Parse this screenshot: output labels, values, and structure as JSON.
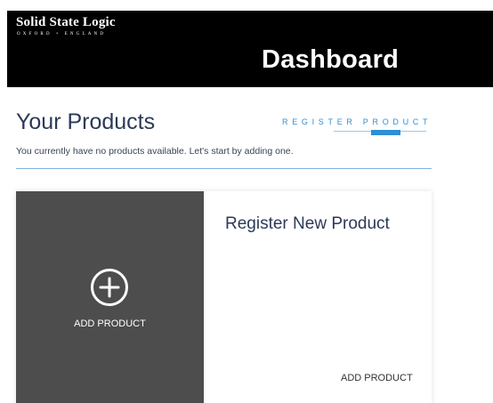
{
  "header": {
    "brand_name": "Solid State Logic",
    "brand_subtitle": "OXFORD • ENGLAND",
    "page_title": "Dashboard"
  },
  "products": {
    "heading": "Your Products",
    "register_link": "REGISTER PRODUCT",
    "empty_message": "You currently have no products available. Let's start by adding one."
  },
  "card": {
    "add_label": "ADD PRODUCT",
    "plus_icon": "plus-circle-icon",
    "title": "Register New Product",
    "action_label": "ADD PRODUCT"
  },
  "colors": {
    "header_bg": "#000000",
    "accent": "#2d8fd5",
    "card_left_bg": "#4d4d4d",
    "heading_text": "#2b3a57"
  }
}
